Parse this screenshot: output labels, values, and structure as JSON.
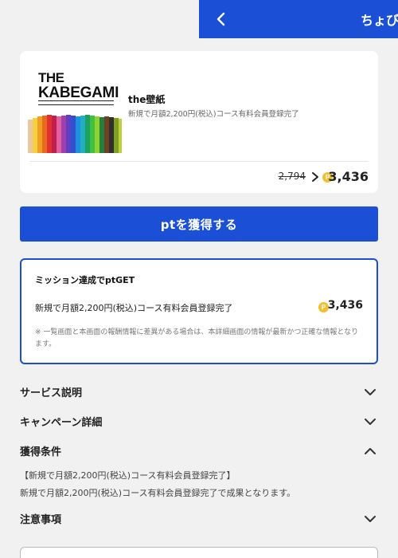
{
  "header": {
    "title": "ちょびリッチ",
    "bg_color": "#1a4fd6"
  },
  "offer": {
    "logo_line1": "THE",
    "logo_line2": "KABEGAMI",
    "name": "the壁紙",
    "description": "新規で月額2,200円(税込)コース有料会員登録完了",
    "old_points": "2,794",
    "new_points": "3,436",
    "coin_symbol": "P"
  },
  "get_button": {
    "label": "ptを獲得する"
  },
  "mission": {
    "title": "ミッション達成でptGET",
    "description": "新規で月額2,200円(税込)コース有料会員登録完了",
    "points": "3,436",
    "coin_symbol": "P",
    "note": "※ 一覧画面と本画面の報酬情報に差異がある場合は、本詳細画面の情報が最新かつ正確な情報となります。"
  },
  "sections": {
    "service": "サービス説明",
    "campaign": "キャンペーン詳細",
    "conditions": "獲得条件",
    "notes": "注意事項"
  },
  "conditions_body": {
    "line1": "【新規で月額2,200円(税込)コース有料会員登録完了】",
    "line2": "新規で月額2,200円(税込)コース有料会員登録完了で成果となります。"
  },
  "colors": {
    "accent": "#1a4fd6",
    "coin": "#f0c030",
    "background": "#f1f1f1"
  }
}
